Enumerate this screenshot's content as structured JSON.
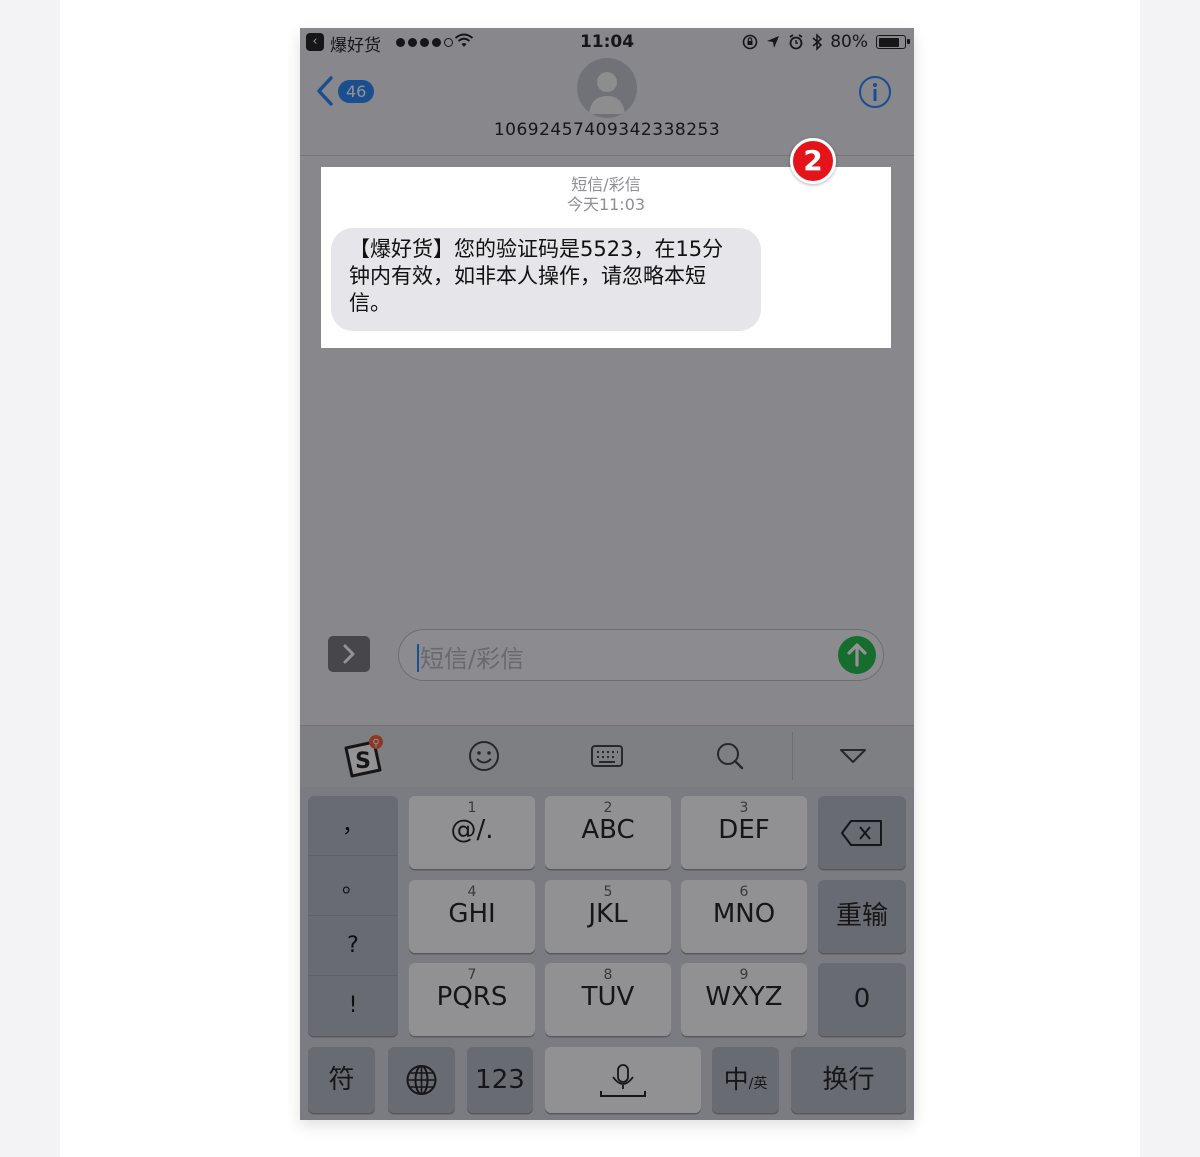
{
  "status_bar": {
    "back_app_name": "爆好货",
    "time": "11:04",
    "battery": "80%",
    "battery_level": 0.8
  },
  "nav": {
    "back_badge": "46",
    "contact_number": "1069245740934233825​3"
  },
  "message": {
    "service_label": "短信/彩信",
    "timestamp": "今天11:03",
    "bubble_text": "【爆好货】您的验证码是5523，在15分钟内有效，如非本人操作，请忽略本短信。"
  },
  "annotation": {
    "marker": "2"
  },
  "input": {
    "placeholder": "短信/彩信"
  },
  "toolbar": {
    "icons": [
      "sogou-icon",
      "emoji-icon",
      "keyboard-icon",
      "search-icon",
      "collapse-icon"
    ]
  },
  "keyboard": {
    "punctuation": [
      "，",
      "。",
      "?",
      "!"
    ],
    "keys": [
      {
        "num": "1",
        "label": "@/."
      },
      {
        "num": "2",
        "label": "ABC"
      },
      {
        "num": "3",
        "label": "DEF"
      },
      {
        "num": "4",
        "label": "GHI"
      },
      {
        "num": "5",
        "label": "JKL"
      },
      {
        "num": "6",
        "label": "MNO"
      },
      {
        "num": "7",
        "label": "PQRS"
      },
      {
        "num": "8",
        "label": "TUV"
      },
      {
        "num": "9",
        "label": "WXYZ"
      }
    ],
    "retype": "重输",
    "zero": "0",
    "symbols": "符",
    "numbers": "123",
    "lang_main": "中",
    "lang_sub": "/英",
    "return": "换行"
  },
  "colors": {
    "accent_blue": "#1a7bf2",
    "send_green": "#10b73b",
    "marker_red": "#e5141a"
  }
}
